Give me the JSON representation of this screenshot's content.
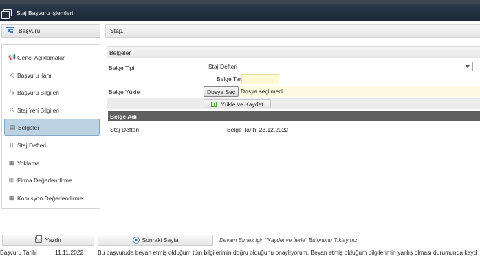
{
  "window": {
    "title": "Staj Başvuru İşlemleri"
  },
  "left_header": {
    "label": "Başvuru"
  },
  "right_header": {
    "label": "Staj1"
  },
  "sidebar": {
    "items": [
      {
        "label": "Genel Açıklamalar",
        "icon": "megaphone-icon",
        "glyph": "📢"
      },
      {
        "label": "Başvuru İlanı",
        "icon": "announcement-icon",
        "glyph": "◁"
      },
      {
        "label": "Başvuru Bilgileri",
        "icon": "transfer-icon",
        "glyph": "⇆"
      },
      {
        "label": "Staj Yeri Bilgileri",
        "icon": "location-icon",
        "glyph": "⤫"
      },
      {
        "label": "Belgeler",
        "icon": "document-icon",
        "glyph": "▤",
        "active": true
      },
      {
        "label": "Staj Defteri",
        "icon": "book-icon",
        "glyph": "▯"
      },
      {
        "label": "Yoklama",
        "icon": "calendar-icon",
        "glyph": "▦"
      },
      {
        "label": "Firma Değerlendirme",
        "icon": "clipboard-icon",
        "glyph": "▥"
      },
      {
        "label": "Komisyon Değerlendirme",
        "icon": "grid-icon",
        "glyph": "▦"
      }
    ]
  },
  "belgeler": {
    "section_title": "Belgeler",
    "belge_tipi_label": "Belge Tipi",
    "belge_tipi_value": "Staj Defteri",
    "belge_tarihi_label": "Belge Tarihi",
    "belge_tarihi_value": "",
    "belge_yukle_label": "Belge Yükle",
    "file_button": "Dosya Seç",
    "file_status": "Dosya seçilmedi",
    "upload_button": "Yükle ve Kaydet"
  },
  "table": {
    "column": "Belge Adı",
    "rows": [
      {
        "name": "Staj Defteri",
        "date": "Belge Tarihi 23.12.2022"
      }
    ]
  },
  "actions": {
    "print": "Yazdır",
    "next": "Sonraki Sayfa",
    "hint": "Devam Etmek için \"Kaydet ve İlerle\" Butonunu Tıklayınız"
  },
  "footer": {
    "date_label": "Başvuru Tarihi",
    "date_value": "11.11.2022",
    "statement": "Bu başvuruda beyan etmiş olduğum tüm bilgilerimin doğru olduğunu onaylıyorum. Beyan etmiş olduğum bilgilerimin yanlış olması durumunda kayd"
  }
}
